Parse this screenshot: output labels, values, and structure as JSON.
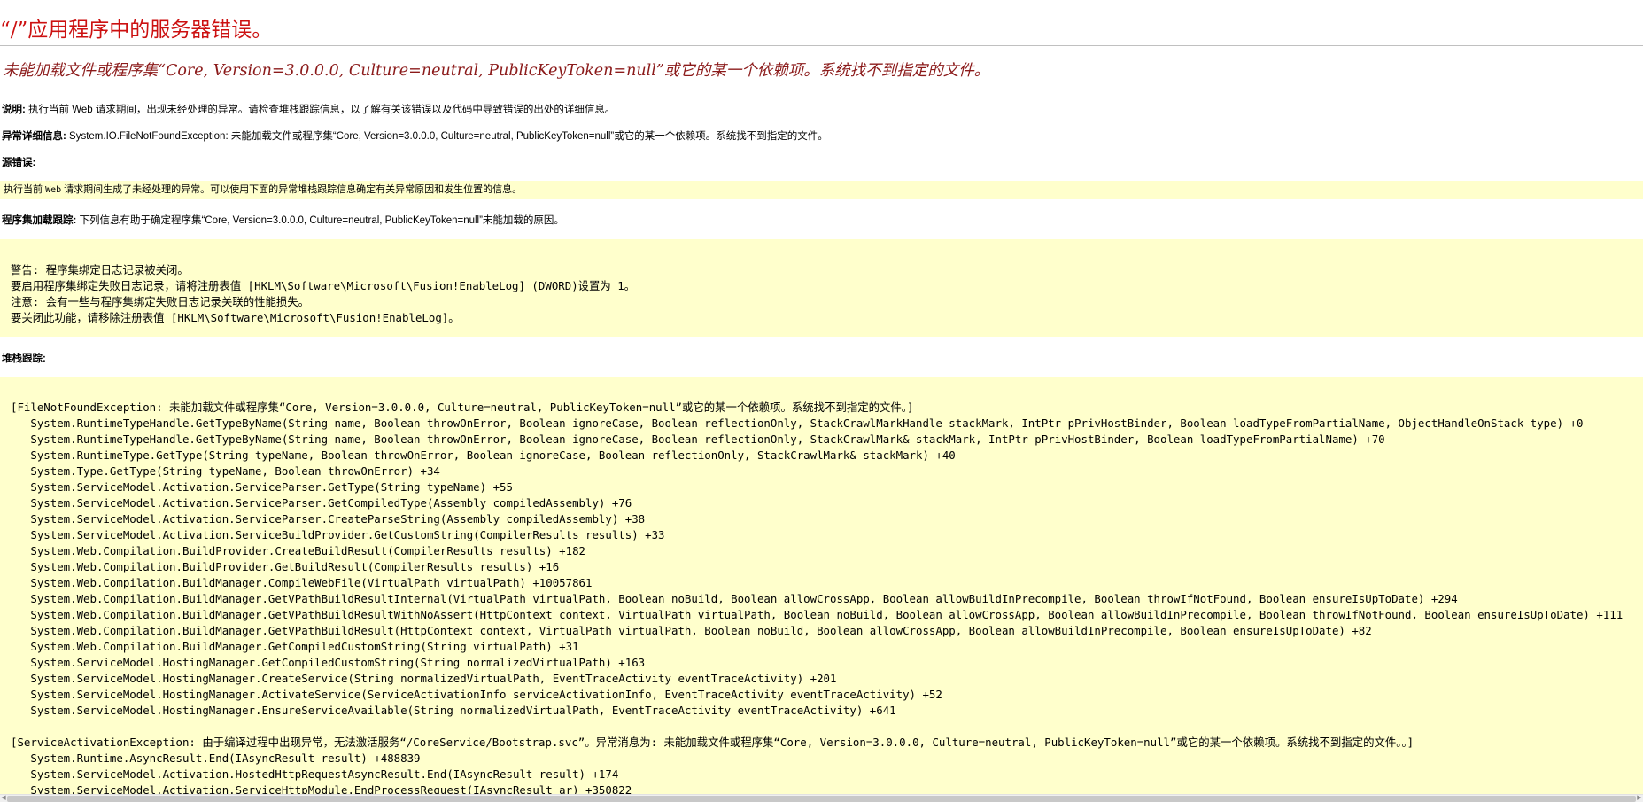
{
  "title": "“/”应用程序中的服务器错误。",
  "subtitle": "未能加载文件或程序集“Core, Version=3.0.0.0, Culture=neutral, PublicKeyToken=null”或它的某一个依赖项。系统找不到指定的文件。",
  "description": {
    "label": "说明:",
    "text": " 执行当前 Web 请求期间，出现未经处理的异常。请检查堆栈跟踪信息，以了解有关该错误以及代码中导致错误的出处的详细信息。"
  },
  "exception_details": {
    "label": "异常详细信息:",
    "text": " System.IO.FileNotFoundException: 未能加载文件或程序集“Core, Version=3.0.0.0, Culture=neutral, PublicKeyToken=null”或它的某一个依赖项。系统找不到指定的文件。"
  },
  "source_error": {
    "label": "源错误:",
    "text_before": "执行当前 ",
    "text_mono": "Web",
    "text_after": " 请求期间生成了未经处理的异常。可以使用下面的异常堆栈跟踪信息确定有关异常原因和发生位置的信息。"
  },
  "assembly_load_trace": {
    "label": "程序集加载跟踪:",
    "text": " 下列信息有助于确定程序集“Core, Version=3.0.0.0, Culture=neutral, PublicKeyToken=null”未能加载的原因。"
  },
  "warning_lines": [
    "警告: 程序集绑定日志记录被关闭。",
    "要启用程序集绑定失败日志记录，请将注册表值 [HKLM\\Software\\Microsoft\\Fusion!EnableLog] (DWORD)设置为 1。",
    "注意: 会有一些与程序集绑定失败日志记录关联的性能损失。",
    "要关闭此功能，请移除注册表值 [HKLM\\Software\\Microsoft\\Fusion!EnableLog]。"
  ],
  "stack_trace": {
    "label": "堆栈跟踪:",
    "block1": [
      "[FileNotFoundException: 未能加载文件或程序集“Core, Version=3.0.0.0, Culture=neutral, PublicKeyToken=null”或它的某一个依赖项。系统找不到指定的文件。]",
      "   System.RuntimeTypeHandle.GetTypeByName(String name, Boolean throwOnError, Boolean ignoreCase, Boolean reflectionOnly, StackCrawlMarkHandle stackMark, IntPtr pPrivHostBinder, Boolean loadTypeFromPartialName, ObjectHandleOnStack type) +0",
      "   System.RuntimeTypeHandle.GetTypeByName(String name, Boolean throwOnError, Boolean ignoreCase, Boolean reflectionOnly, StackCrawlMark& stackMark, IntPtr pPrivHostBinder, Boolean loadTypeFromPartialName) +70",
      "   System.RuntimeType.GetType(String typeName, Boolean throwOnError, Boolean ignoreCase, Boolean reflectionOnly, StackCrawlMark& stackMark) +40",
      "   System.Type.GetType(String typeName, Boolean throwOnError) +34",
      "   System.ServiceModel.Activation.ServiceParser.GetType(String typeName) +55",
      "   System.ServiceModel.Activation.ServiceParser.GetCompiledType(Assembly compiledAssembly) +76",
      "   System.ServiceModel.Activation.ServiceParser.CreateParseString(Assembly compiledAssembly) +38",
      "   System.ServiceModel.Activation.ServiceBuildProvider.GetCustomString(CompilerResults results) +33",
      "   System.Web.Compilation.BuildProvider.CreateBuildResult(CompilerResults results) +182",
      "   System.Web.Compilation.BuildProvider.GetBuildResult(CompilerResults results) +16",
      "   System.Web.Compilation.BuildManager.CompileWebFile(VirtualPath virtualPath) +10057861",
      "   System.Web.Compilation.BuildManager.GetVPathBuildResultInternal(VirtualPath virtualPath, Boolean noBuild, Boolean allowCrossApp, Boolean allowBuildInPrecompile, Boolean throwIfNotFound, Boolean ensureIsUpToDate) +294",
      "   System.Web.Compilation.BuildManager.GetVPathBuildResultWithNoAssert(HttpContext context, VirtualPath virtualPath, Boolean noBuild, Boolean allowCrossApp, Boolean allowBuildInPrecompile, Boolean throwIfNotFound, Boolean ensureIsUpToDate) +111",
      "   System.Web.Compilation.BuildManager.GetVPathBuildResult(HttpContext context, VirtualPath virtualPath, Boolean noBuild, Boolean allowCrossApp, Boolean allowBuildInPrecompile, Boolean ensureIsUpToDate) +82",
      "   System.Web.Compilation.BuildManager.GetCompiledCustomString(String virtualPath) +31",
      "   System.ServiceModel.HostingManager.GetCompiledCustomString(String normalizedVirtualPath) +163",
      "   System.ServiceModel.HostingManager.CreateService(String normalizedVirtualPath, EventTraceActivity eventTraceActivity) +201",
      "   System.ServiceModel.HostingManager.ActivateService(ServiceActivationInfo serviceActivationInfo, EventTraceActivity eventTraceActivity) +52",
      "   System.ServiceModel.HostingManager.EnsureServiceAvailable(String normalizedVirtualPath, EventTraceActivity eventTraceActivity) +641"
    ],
    "block2": [
      "[ServiceActivationException: 由于编译过程中出现异常，无法激活服务“/CoreService/Bootstrap.svc”。异常消息为: 未能加载文件或程序集“Core, Version=3.0.0.0, Culture=neutral, PublicKeyToken=null”或它的某一个依赖项。系统找不到指定的文件。。]",
      "   System.Runtime.AsyncResult.End(IAsyncResult result) +488839",
      "   System.ServiceModel.Activation.HostedHttpRequestAsyncResult.End(IAsyncResult result) +174",
      "   System.ServiceModel.Activation.ServiceHttpModule.EndProcessRequest(IAsyncResult ar) +350822"
    ]
  },
  "colors": {
    "title": "#cc1111",
    "subtitle": "#8b1a1a",
    "code_background": "#ffffcc"
  }
}
